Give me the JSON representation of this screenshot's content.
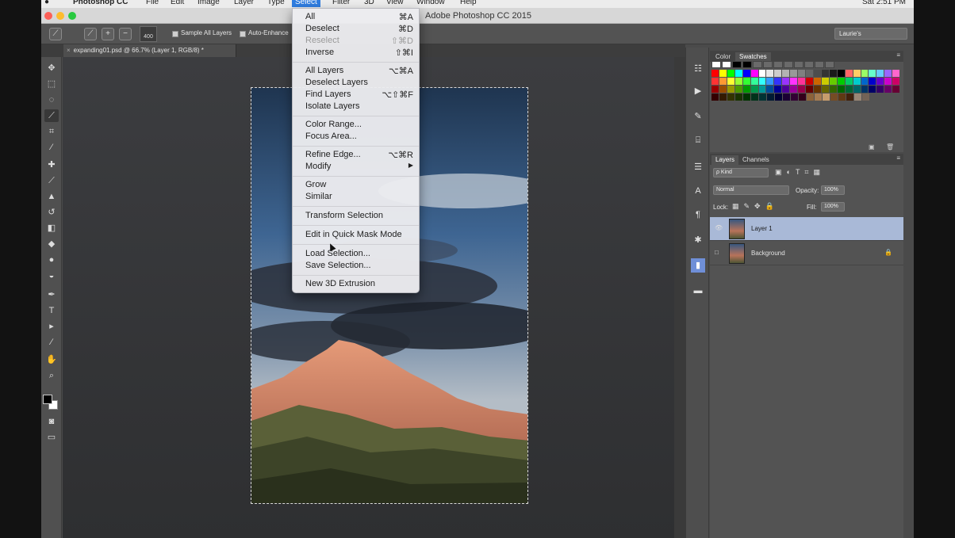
{
  "menubar": {
    "app_name": "Photoshop CC",
    "items": [
      "File",
      "Edit",
      "Image",
      "Layer",
      "Type",
      "Select",
      "Filter",
      "3D",
      "View",
      "Window",
      "Help"
    ],
    "active_item": "Select",
    "clock": "Sat 2:51 PM"
  },
  "window": {
    "title": "Adobe Photoshop CC 2015"
  },
  "options_bar": {
    "brush_size": "400",
    "sample_all_layers_label": "Sample All Layers",
    "auto_enhance_label": "Auto-Enhance",
    "workspace": "Laurie's"
  },
  "document": {
    "tab_title": "expanding01.psd @ 66.7% (Layer 1, RGB/8) *"
  },
  "panels": {
    "color_tab": "Color",
    "swatches_tab": "Swatches",
    "layers_tab": "Layers",
    "channels_tab": "Channels",
    "kind_filter": "ρ Kind",
    "blend_mode": "Normal",
    "opacity_label": "Opacity:",
    "opacity_value": "100%",
    "lock_label": "Lock:",
    "fill_label": "Fill:",
    "fill_value": "100%",
    "layers": [
      {
        "name": "Layer 1",
        "selected": true
      },
      {
        "name": "Background",
        "locked": true
      }
    ]
  },
  "select_menu": {
    "items": [
      {
        "label": "All",
        "shortcut": "⌘A"
      },
      {
        "label": "Deselect",
        "shortcut": "⌘D"
      },
      {
        "label": "Reselect",
        "shortcut": "⇧⌘D",
        "disabled": true
      },
      {
        "label": "Inverse",
        "shortcut": "⇧⌘I"
      },
      {
        "label": "All Layers",
        "shortcut": "⌥⌘A"
      },
      {
        "label": "Deselect Layers",
        "shortcut": ""
      },
      {
        "label": "Find Layers",
        "shortcut": "⌥⇧⌘F"
      },
      {
        "label": "Isolate Layers",
        "shortcut": ""
      },
      {
        "label": "Color Range...",
        "shortcut": ""
      },
      {
        "label": "Focus Area...",
        "shortcut": ""
      },
      {
        "label": "Refine Edge...",
        "shortcut": "⌥⌘R"
      },
      {
        "label": "Modify",
        "shortcut": "▶"
      },
      {
        "label": "Grow",
        "shortcut": ""
      },
      {
        "label": "Similar",
        "shortcut": ""
      },
      {
        "label": "Transform Selection",
        "shortcut": ""
      },
      {
        "label": "Edit in Quick Mask Mode",
        "shortcut": ""
      },
      {
        "label": "Load Selection...",
        "shortcut": ""
      },
      {
        "label": "Save Selection...",
        "shortcut": ""
      },
      {
        "label": "New 3D Extrusion",
        "shortcut": ""
      }
    ]
  },
  "colors": {
    "menu_highlight": "#2f7de1",
    "layer_selected": "#a9b9d7",
    "panel_bg": "#535353"
  }
}
